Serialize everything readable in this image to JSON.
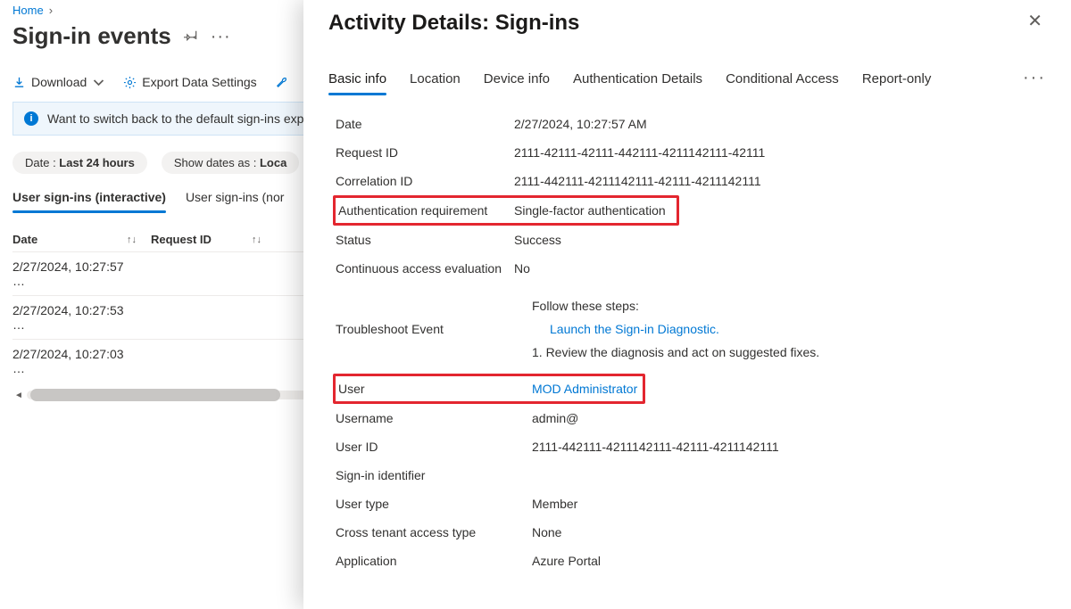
{
  "breadcrumb": {
    "home": "Home"
  },
  "page": {
    "title": "Sign-in events",
    "toolbar": {
      "download": "Download",
      "exportSettings": "Export Data Settings"
    },
    "infoBar": "Want to switch back to the default sign-ins experi",
    "filters": {
      "date": {
        "prefix": "Date : ",
        "value": "Last 24 hours"
      },
      "show": {
        "prefix": "Show dates as : ",
        "value": "Loca"
      }
    },
    "subtabs": {
      "interactive": "User sign-ins (interactive)",
      "noninteractive": "User sign-ins (nor"
    },
    "grid": {
      "headers": {
        "date": "Date",
        "requestId": "Request ID"
      },
      "rows": [
        {
          "date": "2/27/2024, 10:27:57 …"
        },
        {
          "date": "2/27/2024, 10:27:53 …"
        },
        {
          "date": "2/27/2024, 10:27:03 …"
        }
      ]
    }
  },
  "panel": {
    "title": "Activity Details: Sign-ins",
    "tabs": {
      "basic": "Basic info",
      "location": "Location",
      "device": "Device info",
      "auth": "Authentication Details",
      "conditional": "Conditional Access",
      "report": "Report-only"
    },
    "labels": {
      "date": "Date",
      "requestId": "Request ID",
      "correlationId": "Correlation ID",
      "authReq": "Authentication requirement",
      "status": "Status",
      "cae": "Continuous access evaluation",
      "troubleshoot": "Troubleshoot Event",
      "follow": "Follow these steps:",
      "launch": "Launch the Sign-in Diagnostic.",
      "review": "1. Review the diagnosis and act on suggested fixes.",
      "user": "User",
      "username": "Username",
      "userId": "User ID",
      "signinId": "Sign-in identifier",
      "userType": "User type",
      "crossTenant": "Cross tenant access type",
      "application": "Application"
    },
    "values": {
      "date": "2/27/2024, 10:27:57 AM",
      "requestId": "2111-42111-42111-442111-4211142111-42111",
      "correlationId": "2111-442111-4211142111-42111-4211142111",
      "authReq": "Single-factor authentication",
      "status": "Success",
      "cae": "No",
      "user": "MOD Administrator",
      "username": "admin@",
      "userId": "2111-442111-4211142111-42111-4211142111",
      "signinId": "",
      "userType": "Member",
      "crossTenant": "None",
      "application": "Azure Portal"
    }
  }
}
